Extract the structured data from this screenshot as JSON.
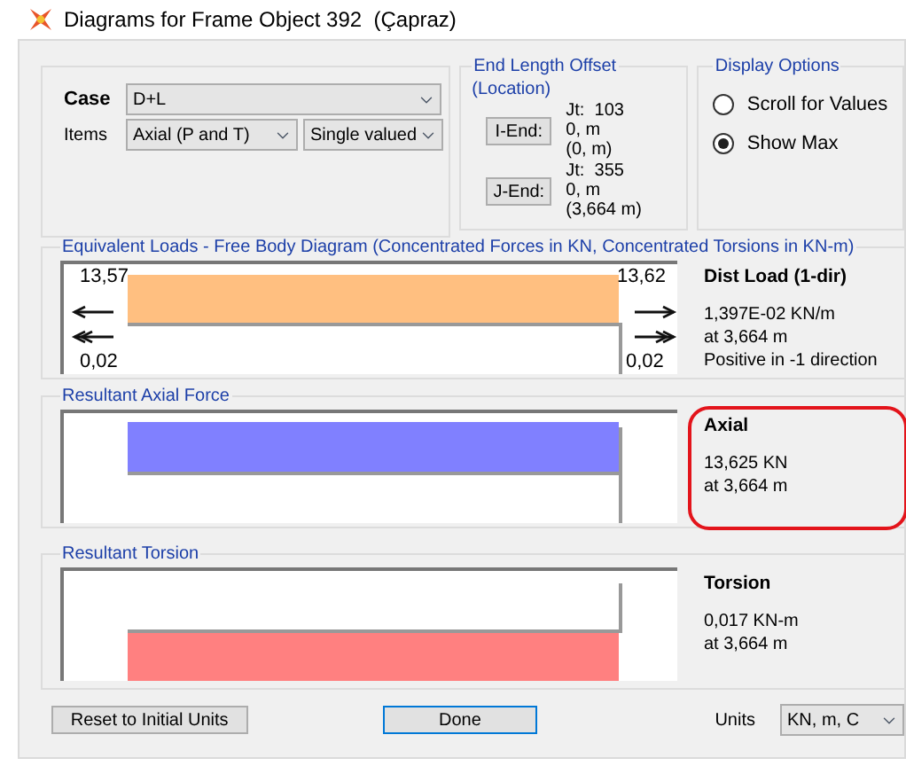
{
  "window": {
    "title": "Diagrams for Frame Object 392  (Çapraz)"
  },
  "case": {
    "label": "Case",
    "value": "D+L"
  },
  "items": {
    "label": "Items",
    "value": "Axial (P and T)",
    "mode": "Single valued"
  },
  "end_length_offset": {
    "title": "End Length Offset",
    "subtitle": "(Location)",
    "ends": [
      {
        "button": "I-End:",
        "joint": "Jt:  103",
        "offset": "0, m",
        "location": "(0, m)"
      },
      {
        "button": "J-End:",
        "joint": "Jt:  355",
        "offset": "0, m",
        "location": "(3,664 m)"
      }
    ]
  },
  "display_options": {
    "title": "Display Options",
    "options": [
      {
        "label": "Scroll for Values",
        "selected": false
      },
      {
        "label": "Show Max",
        "selected": true
      }
    ]
  },
  "panels": [
    {
      "kind": "loads",
      "title": "Equivalent Loads - Free Body Diagram  (Concentrated Forces in KN, Concentrated Torsions in KN-m)",
      "color": "#ffbf80",
      "highlighted": false,
      "values": [
        "13,57",
        "13,62",
        "0,02",
        "0,02"
      ],
      "heading": "Dist Load (1-dir)",
      "lines": [
        "1,397E-02 KN/m",
        "at 3,664 m",
        "Positive in -1 direction"
      ]
    },
    {
      "kind": "axial",
      "title": "Resultant Axial Force",
      "color": "#8080ff",
      "highlighted": true,
      "heading": "Axial",
      "lines": [
        "13,625 KN",
        "at 3,664 m"
      ]
    },
    {
      "kind": "torsion",
      "title": "Resultant Torsion",
      "color": "#ff8080",
      "highlighted": false,
      "heading": "Torsion",
      "lines": [
        "0,017 KN-m",
        "at 3,664 m"
      ]
    }
  ],
  "buttons": {
    "reset": "Reset to Initial Units",
    "done": "Done"
  },
  "units": {
    "label": "Units",
    "value": "KN, m, C"
  }
}
